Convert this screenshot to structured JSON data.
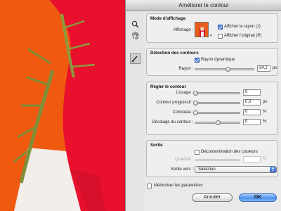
{
  "window": {
    "title": "Améliorer le contour"
  },
  "tools": [
    {
      "icon": "zoom-icon"
    },
    {
      "icon": "hand-icon"
    },
    {
      "icon": "refine-radius-brush-icon"
    }
  ],
  "display_mode": {
    "heading": "Mode d'affichage",
    "view_label": "Affichage :",
    "show_radius_label": "Afficher le rayon (J)",
    "show_radius_checked": true,
    "show_original_label": "Afficher l'original (P)",
    "show_original_checked": false
  },
  "edge_detection": {
    "heading": "Détection des contours",
    "smart_radius_label": "Rayon dynamique",
    "smart_radius_checked": true,
    "radius_label": "Rayon :",
    "radius_value": "34,2",
    "radius_unit": "px",
    "radius_slider": 0.55
  },
  "adjust_edge": {
    "heading": "Régler le contour",
    "rows": [
      {
        "label": "Lissage :",
        "value": "0",
        "unit": "",
        "slider": 0.0
      },
      {
        "label": "Contour progressif :",
        "value": "0,0",
        "unit": "px",
        "slider": 0.0
      },
      {
        "label": "Contraste :",
        "value": "0",
        "unit": "%",
        "slider": 0.0
      },
      {
        "label": "Décalage du contour :",
        "value": "0",
        "unit": "%",
        "slider": 0.5
      }
    ]
  },
  "output": {
    "heading": "Sortie",
    "decontaminate_label": "Décontamination des couleurs",
    "decontaminate_checked": false,
    "amount_label": "Quantité :",
    "amount_unit": "%",
    "output_to_label": "Sortie vers :",
    "output_to_value": "Sélection"
  },
  "footer": {
    "remember_label": "Mémoriser les paramètres",
    "remember_checked": false,
    "cancel_label": "Annuler",
    "ok_label": "OK"
  },
  "colors": {
    "accent": "#3a7ae0",
    "photo_background": "#ef5a10",
    "hair": "#e8102c"
  }
}
